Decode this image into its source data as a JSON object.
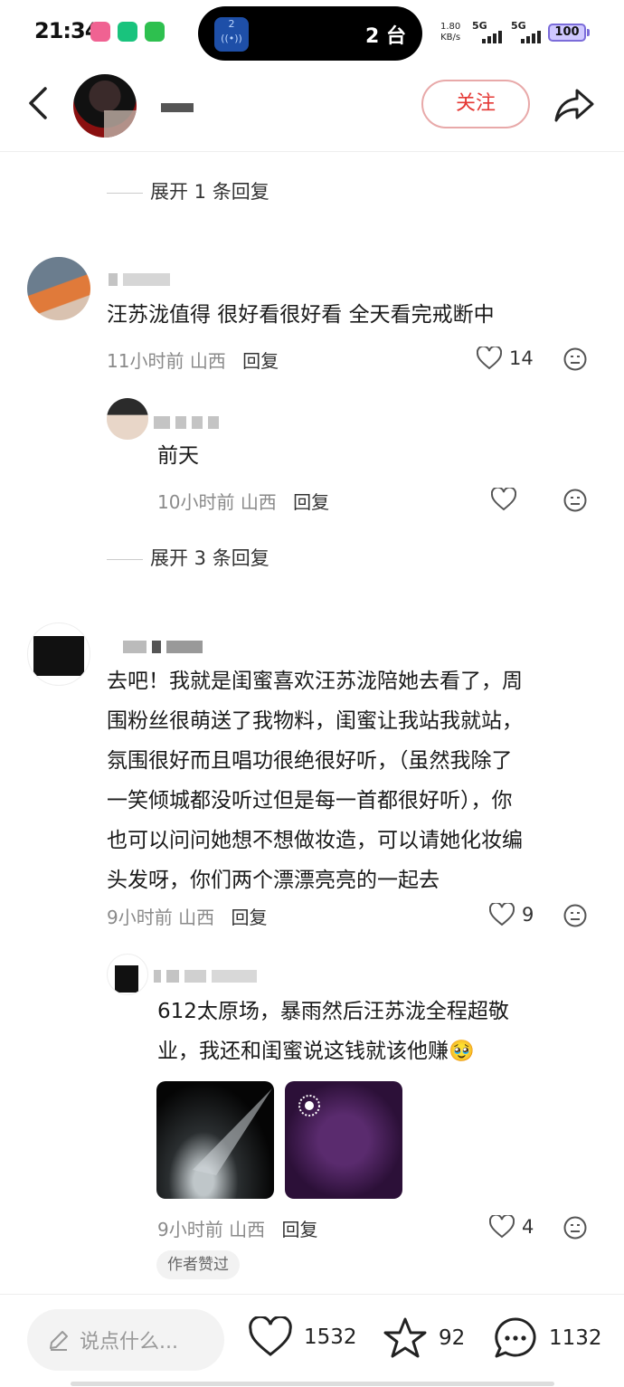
{
  "status_bar": {
    "time": "21:34",
    "island_badge": "2",
    "island_text": "2 台",
    "net_speed_value": "1.80",
    "net_speed_unit": "KB/s",
    "signal1": "5G",
    "signal2": "5G",
    "battery": "100"
  },
  "header": {
    "follow_label": "关注"
  },
  "comments": [
    {
      "expand_label": "展开 1 条回复"
    },
    {
      "text": "汪苏泷值得 很好看很好看 全天看完戒断中",
      "time": "11小时前",
      "location": "山西",
      "reply_label": "回复",
      "likes": "14"
    },
    {
      "text": "前天",
      "time": "10小时前",
      "location": "山西",
      "reply_label": "回复",
      "likes": ""
    },
    {
      "expand_label": "展开 3 条回复"
    },
    {
      "text_lines": [
        "去吧！我就是闺蜜喜欢汪苏泷陪她去看了，周",
        "围粉丝很萌送了我物料，闺蜜让我站我就站，",
        "氛围很好而且唱功很绝很好听，（虽然我除了",
        "一笑倾城都没听过但是每一首都很好听），你",
        "也可以问问她想不想做妆造，可以请她化妆编",
        "头发呀，你们两个漂漂亮亮的一起去"
      ],
      "time": "9小时前",
      "location": "山西",
      "reply_label": "回复",
      "likes": "9"
    },
    {
      "text_lines": [
        "612太原场，暴雨然后汪苏泷全程超敬",
        "业，我还和闺蜜说这钱就该他赚🥹"
      ],
      "time": "9小时前",
      "location": "山西",
      "reply_label": "回复",
      "likes": "4",
      "badge": "作者赞过"
    }
  ],
  "bottom_bar": {
    "input_placeholder": "说点什么...",
    "likes": "1532",
    "stars": "92",
    "comments": "1132"
  },
  "colors": {
    "accent": "#e53935",
    "meta": "#8a8a8a"
  }
}
